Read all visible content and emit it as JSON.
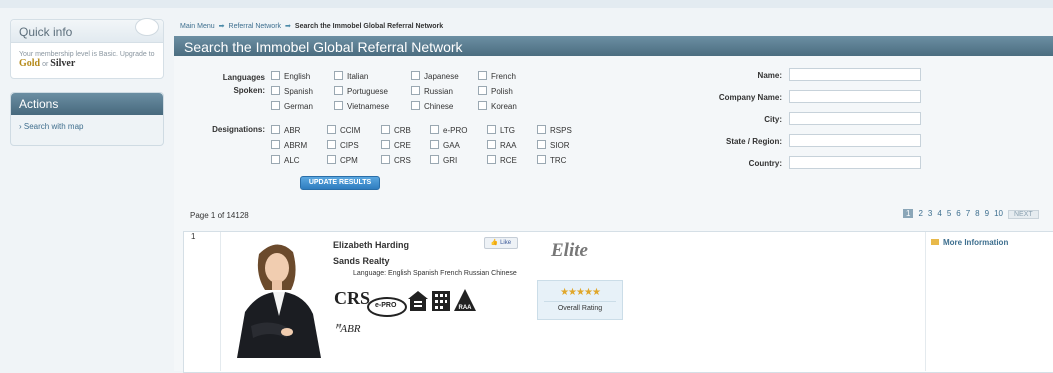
{
  "sidebar": {
    "quick_info": {
      "title": "Quick info",
      "text": "Your membership level is Basic. Upgrade to",
      "gold": "Gold",
      "or": "or",
      "silver": "Silver"
    },
    "actions": {
      "title": "Actions",
      "items": [
        "Search with map"
      ]
    }
  },
  "breadcrumb": [
    "Main Menu",
    "Referral Network",
    "Search the Immobel Global Referral Network"
  ],
  "header": {
    "title": "Search the Immobel Global Referral Network"
  },
  "filters": {
    "languages_label": "Languages Spoken:",
    "languages": [
      "English",
      "Italian",
      "Japanese",
      "French",
      "Spanish",
      "Portuguese",
      "Russian",
      "Polish",
      "German",
      "Vietnamese",
      "Chinese",
      "Korean"
    ],
    "designations_label": "Designations:",
    "designations": [
      "ABR",
      "CCIM",
      "CRB",
      "e-PRO",
      "LTG",
      "RSPS",
      "ABRM",
      "CIPS",
      "CRE",
      "GAA",
      "RAA",
      "SIOR",
      "ALC",
      "CPM",
      "CRS",
      "GRI",
      "RCE",
      "TRC"
    ],
    "update_button": "UPDATE RESULTS",
    "fields": [
      "Name:",
      "Company Name:",
      "City:",
      "State / Region:",
      "Country:"
    ]
  },
  "pagination": {
    "page_of": "Page 1 of 14128",
    "pages": [
      "1",
      "2",
      "3",
      "4",
      "5",
      "6",
      "7",
      "8",
      "9",
      "10"
    ],
    "next": "NEXT"
  },
  "listing": {
    "index": "1",
    "name": "Elizabeth Harding",
    "company": "Sands Realty",
    "language": "Language: English Spanish French Russian Chinese",
    "like": "Like",
    "elite": "Elite",
    "stars": "★★★★★",
    "rating_label": "Overall Rating",
    "more": "More Information",
    "logos": [
      "CRS",
      "e-PRO",
      "ABR",
      "RAA"
    ]
  },
  "colors": {
    "header_bar": "#5a7d91",
    "link": "#3e6f8f",
    "gold": "#b58a1a",
    "button": "#3a88c9"
  }
}
